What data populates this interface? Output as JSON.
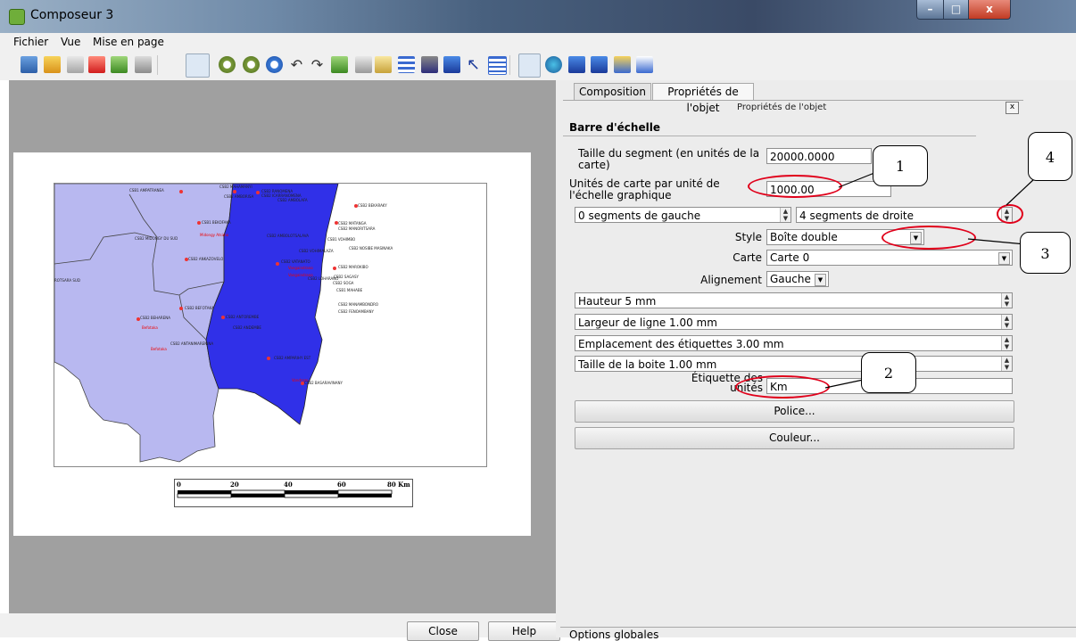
{
  "window": {
    "title": "Composeur 3",
    "min": "–",
    "max": "□",
    "close": "x"
  },
  "menu": [
    "Fichier",
    "Vue",
    "Mise en page"
  ],
  "map": {
    "labels": [
      {
        "t": "CSB1 AMPATRANEA",
        "red": false
      },
      {
        "t": "CSB2 MAHAMANYI",
        "red": false
      },
      {
        "t": "CSB2 AMBORISA",
        "red": false
      },
      {
        "t": "CSB2 RANOMENA",
        "red": false
      },
      {
        "t": "CSB2 ICARRANOMENA",
        "red": false
      },
      {
        "t": "CSB2 AMBOLAFA",
        "red": false
      },
      {
        "t": "CSB2 BEKARAKY",
        "red": false
      },
      {
        "t": "CSB1 BEKOFAKA",
        "red": false
      },
      {
        "t": "Midongy Atsimo",
        "red": true
      },
      {
        "t": "CSB2 MIDONGY DU SUD",
        "red": false
      },
      {
        "t": "CSB2 AMBOLOTSALAVA",
        "red": false
      },
      {
        "t": "CSB2 MATANGA",
        "red": false
      },
      {
        "t": "CSB2 MANORITSARA",
        "red": false
      },
      {
        "t": "CSB1 VOHIMBO",
        "red": false
      },
      {
        "t": "CSB2 VOHIMALAZA",
        "red": false
      },
      {
        "t": "CSB2 NOSIBE MASINAKA",
        "red": false
      },
      {
        "t": "CSB2 ANKAZOVELO",
        "red": false
      },
      {
        "t": "CSB2 VATANATO",
        "red": false
      },
      {
        "t": "Vangaindrano",
        "red": true
      },
      {
        "t": "CSB2 MAROKIBO",
        "red": false
      },
      {
        "t": "Vangaindrano",
        "red": true
      },
      {
        "t": "CSB2 LOHARANO",
        "red": false
      },
      {
        "t": "CSB2 SAGASY",
        "red": false
      },
      {
        "t": "CSB2 SOGA",
        "red": false
      },
      {
        "t": "ROTSARA SUD",
        "red": false
      },
      {
        "t": "CSB1 MAHABE",
        "red": false
      },
      {
        "t": "CSB2 BEFOTAKA",
        "red": false
      },
      {
        "t": "CSB2 MANAMBONDRO",
        "red": false
      },
      {
        "t": "CSB2 FENOAMBANY",
        "red": false
      },
      {
        "t": "CSB2 BEHARENA",
        "red": false
      },
      {
        "t": "CSB2 ANTOREMBE",
        "red": false
      },
      {
        "t": "Befotaka",
        "red": true
      },
      {
        "t": "CSB2 ANDEMBE",
        "red": false
      },
      {
        "t": "CSB2 ANTANIMARENINA",
        "red": false
      },
      {
        "t": "Befotaka",
        "red": true
      },
      {
        "t": "CSB2 AMPARIHY EST",
        "red": false
      },
      {
        "t": "Vondrozo",
        "red": true
      },
      {
        "t": "CSB2 BASARAVINANY",
        "red": false
      }
    ]
  },
  "scalebar": {
    "ticks": [
      "0",
      "20",
      "40",
      "60",
      "80 Km"
    ]
  },
  "bottom": {
    "close": "Close",
    "help": "Help",
    "global_options": "Options globales"
  },
  "panel": {
    "tabs": [
      "Composition",
      "Propriétés de l'objet"
    ],
    "dock_title": "Propriétés de l'objet",
    "dock_close": "x",
    "section": "Barre d'échelle",
    "segment_size_label": "Taille du segment (en unités de la carte)",
    "segment_size_value": "20000.0000",
    "map_units_label": "Unités de carte par unité de l'échelle graphique",
    "map_units_value": "1000.00",
    "left_segments": "0 segments de gauche",
    "right_segments": "4 segments de droite",
    "style_label": "Style",
    "style_value": "Boîte double",
    "map_label": "Carte",
    "map_value": "Carte 0",
    "alignment_label": "Alignement",
    "alignment_value": "Gauche",
    "height": "Hauteur 5 mm",
    "line_width": "Largeur de ligne 1.00 mm",
    "label_spacing": "Emplacement des étiquettes 3.00 mm",
    "box_size": "Taille de la boite 1.00 mm",
    "units_label": "Étiquette des unités",
    "units_value": "Km",
    "font_button": "Police...",
    "color_button": "Couleur..."
  },
  "callouts": [
    "1",
    "2",
    "3",
    "4"
  ],
  "colors": {
    "highlight": "#e0001a",
    "map_dark": "#3030e8",
    "map_light": "#b8b8f0"
  }
}
